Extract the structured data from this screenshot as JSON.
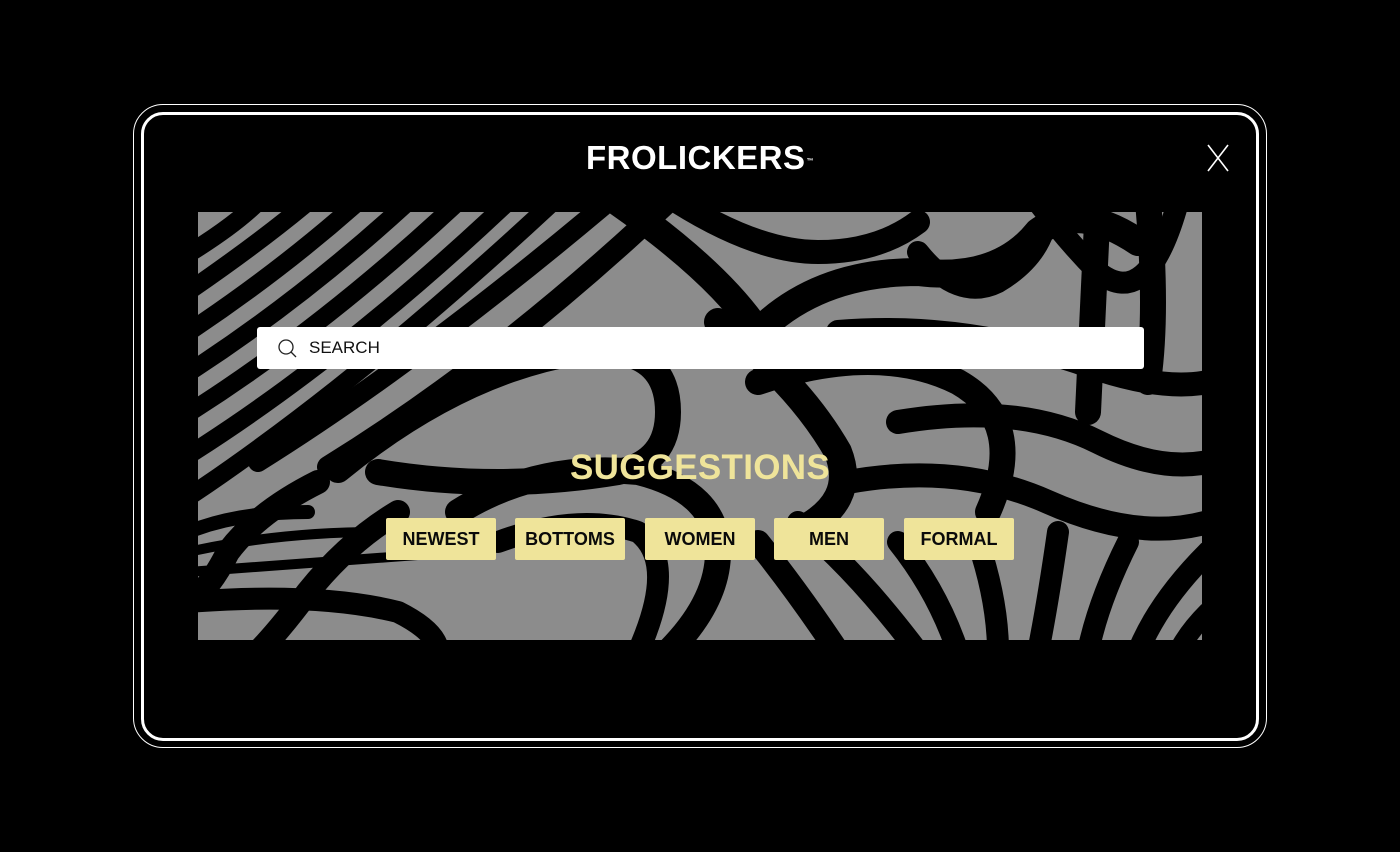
{
  "brand": {
    "name": "FROLICKERS",
    "trademark": "™"
  },
  "close": {
    "label": "X"
  },
  "search": {
    "placeholder": "SEARCH",
    "icon": "search-icon"
  },
  "suggestions": {
    "title": "SUGGESTIONS",
    "items": [
      {
        "label": "NEWEST"
      },
      {
        "label": "BOTTOMS"
      },
      {
        "label": "WOMEN"
      },
      {
        "label": "MEN"
      },
      {
        "label": "FORMAL"
      }
    ]
  },
  "colors": {
    "background": "#000000",
    "accent": "#efe49a",
    "pattern_light": "#8c8c8c",
    "pattern_dark": "#000000"
  }
}
